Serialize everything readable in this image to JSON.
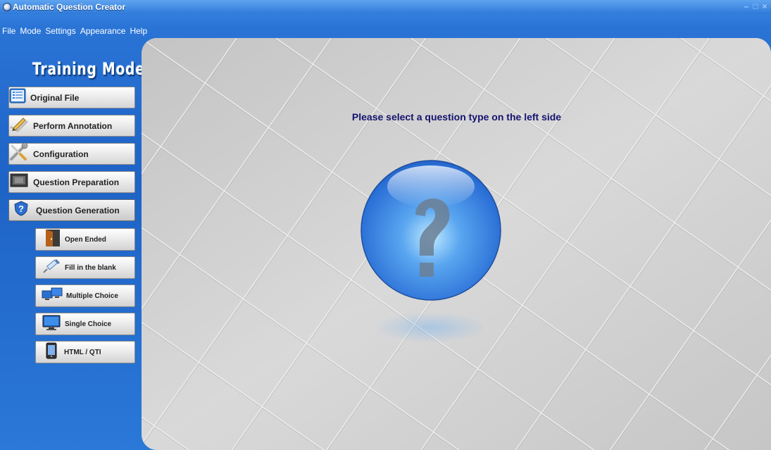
{
  "window": {
    "title": "Automatic Question Creator",
    "controls": {
      "minimize": "–",
      "maximize": "□",
      "close": "×"
    }
  },
  "menu": [
    "File",
    "Mode",
    "Settings",
    "Appearance",
    "Help"
  ],
  "sidebar": {
    "title": "Training Mode",
    "items": [
      {
        "label": "Original File",
        "icon": "document-list-icon"
      },
      {
        "label": "Perform Annotation",
        "icon": "pencil-check-icon"
      },
      {
        "label": "Configuration",
        "icon": "wrench-screwdriver-icon"
      },
      {
        "label": "Question Preparation",
        "icon": "film-book-icon"
      },
      {
        "label": "Question Generation",
        "icon": "shield-question-icon",
        "active": true
      }
    ],
    "subitems": [
      {
        "label": "Open Ended",
        "icon": "door-icon"
      },
      {
        "label": "Fill in the blank",
        "icon": "syringe-icon"
      },
      {
        "label": "Multiple Choice",
        "icon": "monitors-icon"
      },
      {
        "label": "Single Choice",
        "icon": "monitor-icon"
      },
      {
        "label": "HTML / QTI",
        "icon": "device-icon"
      }
    ]
  },
  "main": {
    "prompt": "Please select a question type on the left side",
    "center_icon": "question-mark-ball-icon",
    "colors": {
      "prompt": "#14146e",
      "ball": "#3d86e8",
      "background_tiles": "#cfcfcf"
    }
  }
}
